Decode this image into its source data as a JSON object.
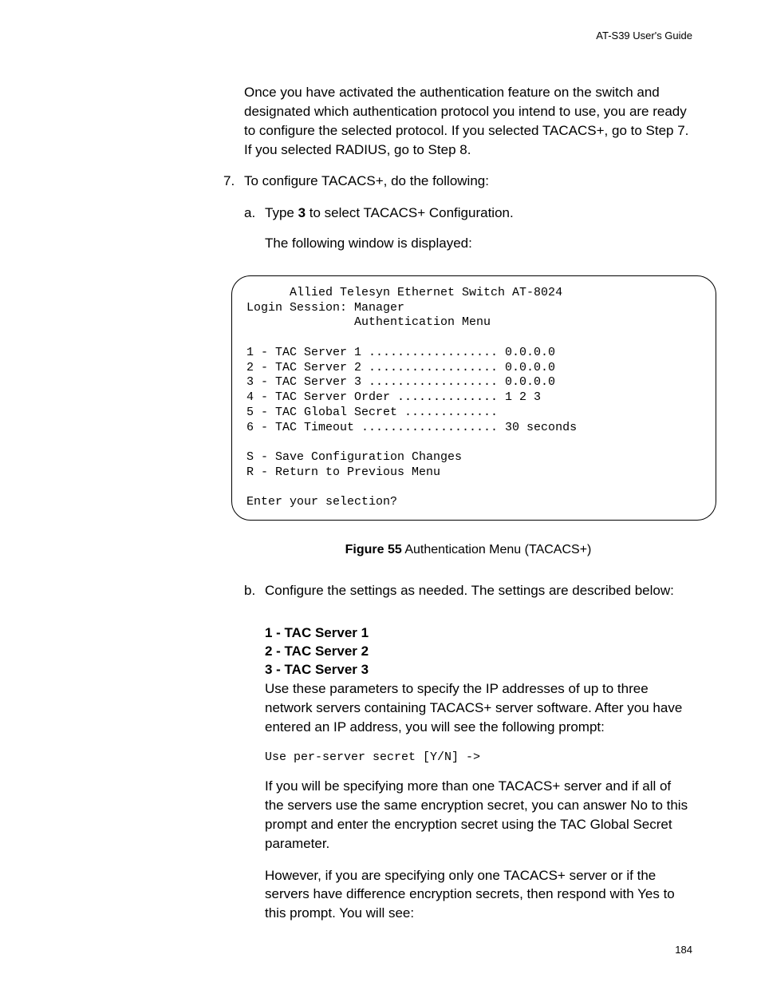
{
  "header": "AT-S39 User's Guide",
  "intro_para": "Once you have activated the authentication feature on the switch and designated which authentication protocol you intend to use, you are ready to configure the selected protocol. If you selected TACACS+, go to Step 7. If you selected RADIUS, go to Step 8.",
  "step7": {
    "number": "7.",
    "text": "To configure TACACS+, do the following:",
    "sub_a": {
      "letter": "a.",
      "line1_pre": "Type ",
      "line1_bold": "3",
      "line1_post": " to select TACACS+ Configuration.",
      "line2": "The following window is displayed:"
    },
    "terminal": "      Allied Telesyn Ethernet Switch AT-8024\nLogin Session: Manager\n               Authentication Menu\n\n1 - TAC Server 1 .................. 0.0.0.0\n2 - TAC Server 2 .................. 0.0.0.0\n3 - TAC Server 3 .................. 0.0.0.0\n4 - TAC Server Order .............. 1 2 3\n5 - TAC Global Secret .............\n6 - TAC Timeout ................... 30 seconds\n\nS - Save Configuration Changes\nR - Return to Previous Menu\n\nEnter your selection?",
    "figure": {
      "label": "Figure 55",
      "caption": "  Authentication Menu (TACACS+)"
    },
    "sub_b": {
      "letter": "b.",
      "text": "Configure the settings as needed. The settings are described below:",
      "param1": "1 - TAC Server 1",
      "param2": "2 - TAC Server 2",
      "param3": "3 - TAC Server 3",
      "desc1": "Use these parameters to specify the IP addresses of up to three network servers containing TACACS+ server software. After you have entered an IP address, you will see the following prompt:",
      "prompt": "Use per-server secret [Y/N] ->",
      "desc2": "If you will be specifying more than one TACACS+ server and if all of the servers use the same encryption secret, you can answer No to this prompt and enter the encryption secret using the TAC Global Secret parameter.",
      "desc3": "However, if you are specifying only one TACACS+ server or if the servers have difference encryption secrets, then respond with Yes to this prompt. You will see:"
    }
  },
  "page_number": "184"
}
